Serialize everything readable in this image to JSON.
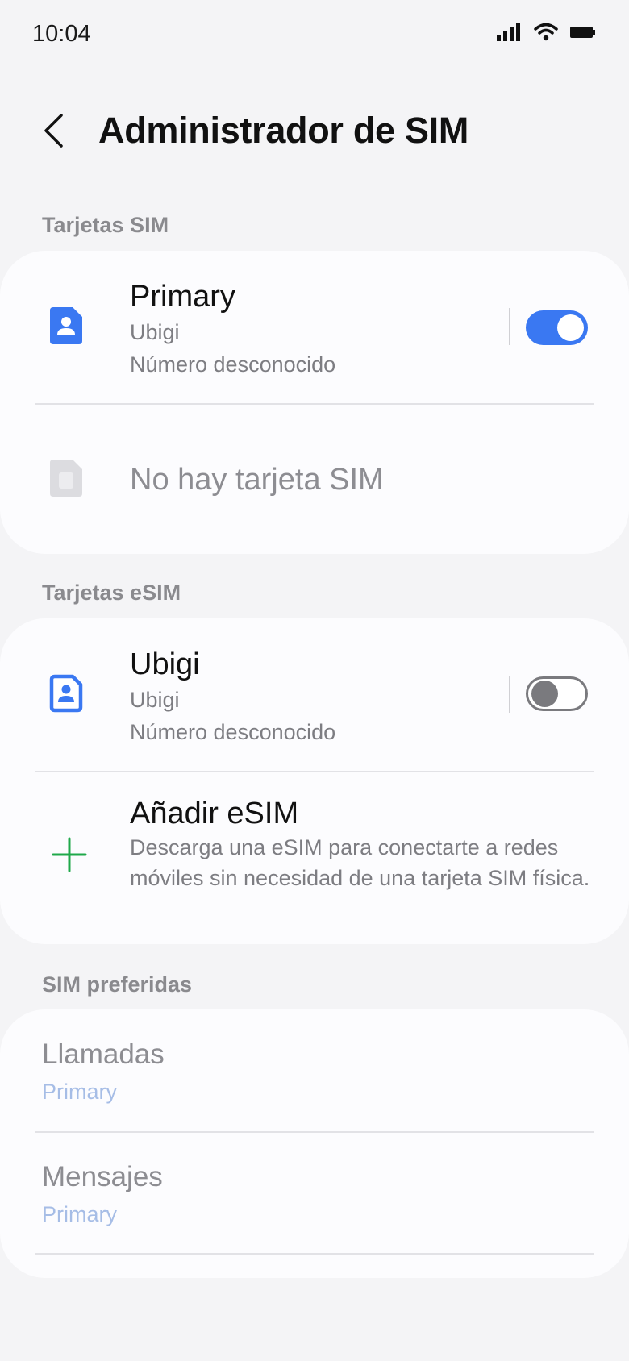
{
  "status_bar": {
    "time": "10:04",
    "icons": [
      "signal-icon",
      "wifi-icon",
      "battery-icon"
    ]
  },
  "header": {
    "back_icon": "back-arrow-icon",
    "title": "Administrador de SIM"
  },
  "sim_section": {
    "label": "Tarjetas SIM",
    "primary": {
      "title": "Primary",
      "carrier": "Ubigi",
      "number": "Número desconocido",
      "enabled": true,
      "icon": "sim-card-icon"
    },
    "empty_slot": {
      "title": "No hay tarjeta SIM",
      "icon": "sim-card-empty-icon"
    }
  },
  "esim_section": {
    "label": "Tarjetas eSIM",
    "ubigi": {
      "title": "Ubigi",
      "carrier": "Ubigi",
      "number": "Número desconocido",
      "enabled": false,
      "icon": "esim-card-icon"
    },
    "add": {
      "title": "Añadir eSIM",
      "description": "Descarga una eSIM para conectarte a redes móviles sin necesidad de una tarjeta SIM física.",
      "icon": "plus-icon"
    }
  },
  "preferred_section": {
    "label": "SIM preferidas",
    "calls": {
      "title": "Llamadas",
      "value": "Primary"
    },
    "messages": {
      "title": "Mensajes",
      "value": "Primary"
    }
  },
  "colors": {
    "accent": "#3a78f2",
    "add_icon": "#1fa94a",
    "pref_value": "#a6bde6",
    "background": "#f4f4f6",
    "card": "#fcfcfe"
  }
}
